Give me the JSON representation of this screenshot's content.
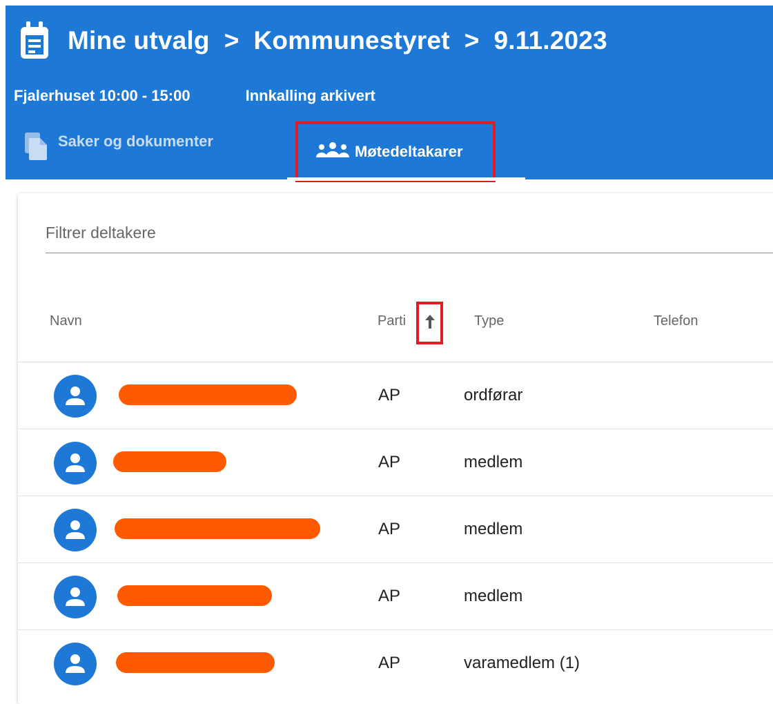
{
  "header": {
    "breadcrumbs": [
      "Mine utvalg",
      "Kommunestyret",
      "9.11.2023"
    ],
    "separator": ">",
    "location_time": "Fjalerhuset 10:00 - 15:00",
    "status": "Innkalling arkivert",
    "tabs": [
      {
        "label": "Saker og dokumenter",
        "icon": "documents-icon"
      },
      {
        "label": "Møtedeltakarer",
        "icon": "people-icon"
      }
    ]
  },
  "filter": {
    "placeholder": "Filtrer deltakere"
  },
  "table": {
    "columns": [
      "Navn",
      "Parti",
      "Type",
      "Telefon"
    ],
    "sort_icon": "arrow-up-icon",
    "rows": [
      {
        "parti": "AP",
        "type": "ordførar"
      },
      {
        "parti": "AP",
        "type": "medlem"
      },
      {
        "parti": "AP",
        "type": "medlem"
      },
      {
        "parti": "AP",
        "type": "medlem"
      },
      {
        "parti": "AP",
        "type": "varamedlem (1)"
      }
    ]
  },
  "colors": {
    "header_blue": "#1e78d6",
    "highlight_red": "#e01b24",
    "redaction_orange": "#ff5a00"
  }
}
